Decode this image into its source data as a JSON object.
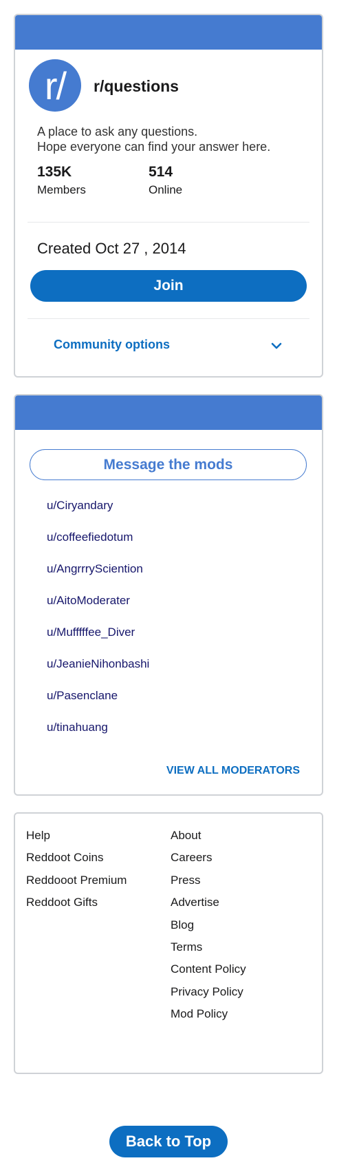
{
  "community": {
    "avatar_text": "r/",
    "name": "r/questions",
    "description_line1": "A place to ask any questions.",
    "description_line2": "Hope everyone can find your answer here.",
    "members_count": "135K",
    "members_label": "Members",
    "online_count": "514",
    "online_label": "Online",
    "created": "Created Oct 27 , 2014",
    "join_label": "Join",
    "options_label": "Community options",
    "options_icon": "chevron-down-icon"
  },
  "mods": {
    "message_label": "Message the mods",
    "list": [
      "u/Ciryandary",
      "u/coffeefiedotum",
      "u/AngrrrySciention",
      "u/AitoModerater",
      "u/Mufffffee_Diver",
      "u/JeanieNihonbashi",
      "u/Pasenclane",
      "u/tinahuang"
    ],
    "view_all_label": "VIEW ALL MODERATORS"
  },
  "footer": {
    "left_links": [
      "Help",
      "Reddoot Coins",
      "Reddooot Premium",
      "Reddoot Gifts"
    ],
    "right_links": [
      "About",
      "Careers",
      "Press",
      "Advertise",
      "Blog",
      "Terms",
      "Content Policy",
      "Privacy Policy",
      "Mod Policy"
    ]
  },
  "back_to_top_label": "Back to Top",
  "colors": {
    "header_blue": "#457bd0",
    "button_blue": "#0d6ec1",
    "mod_link": "#16166b"
  }
}
